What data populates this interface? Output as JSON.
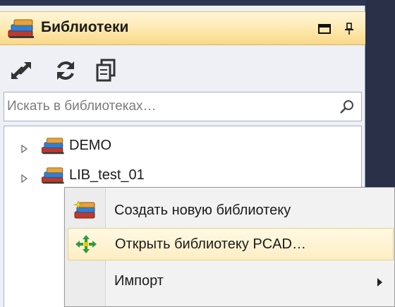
{
  "panel": {
    "title": "Библиотеки",
    "title_icon": "library-stack-icon",
    "controls": [
      "restore-window-icon",
      "pin-icon"
    ]
  },
  "toolbar": {
    "buttons": [
      {
        "icon": "swap-arrows-icon"
      },
      {
        "icon": "refresh-icon"
      },
      {
        "icon": "copy-pages-icon"
      }
    ]
  },
  "search": {
    "placeholder": "Искать в библиотеках…",
    "value": "",
    "icon": "search-icon"
  },
  "tree": {
    "items": [
      {
        "label": "DEMO",
        "icon": "library-stack-icon"
      },
      {
        "label": "LIB_test_01",
        "icon": "library-stack-icon"
      }
    ]
  },
  "context_menu": {
    "items": [
      {
        "label": "Создать новую библиотеку",
        "icon": "new-library-icon"
      },
      {
        "label": "Открыть библиотеку PCAD…",
        "icon": "open-pcad-icon",
        "highlighted": true
      },
      {
        "label": "Импорт",
        "submenu": true
      }
    ]
  },
  "colors": {
    "header_gradient_top": "#fff6d8",
    "header_gradient_bottom": "#f9d98a",
    "menu_highlight": "#fdeec3",
    "frame_dark": "#2a3048"
  }
}
